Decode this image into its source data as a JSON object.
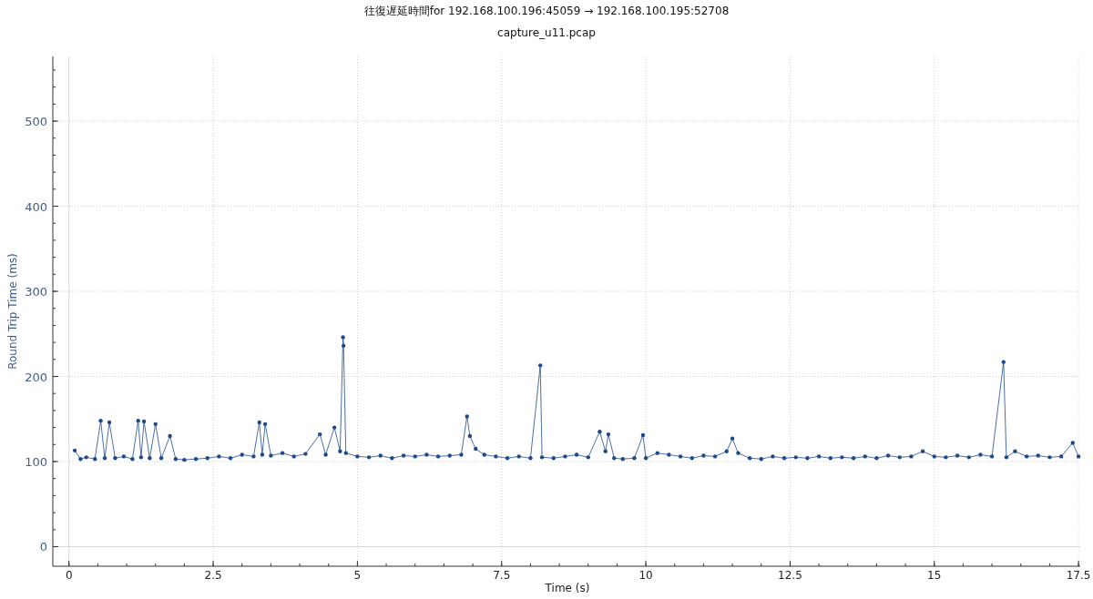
{
  "graph": {
    "subtitle": "capture_u11.pcap",
    "chart_data": {
      "type": "line",
      "title": "往復遅延時間for 192.168.100.196:45059 → 192.168.100.195:52708",
      "xlabel": "Time (s)",
      "ylabel": "Round Trip Time (ms)",
      "grid": true,
      "xlim": [
        -0.28,
        17.53
      ],
      "ylim": [
        -23,
        576
      ],
      "xticks": [
        0,
        {
          "value": 2.5,
          "label": "2.5"
        },
        5,
        {
          "value": 7.5,
          "label": "7.5"
        },
        10,
        {
          "value": 12.5,
          "label": "12.5"
        },
        15,
        {
          "value": 17.5,
          "label": "17.5"
        }
      ],
      "yticks": [
        0,
        100,
        200,
        300,
        400,
        500
      ],
      "x": [
        0.1,
        0.2,
        0.3,
        0.45,
        0.55,
        0.62,
        0.7,
        0.8,
        0.95,
        1.1,
        1.2,
        1.25,
        1.3,
        1.4,
        1.5,
        1.6,
        1.75,
        1.85,
        2.0,
        2.2,
        2.4,
        2.6,
        2.8,
        3.0,
        3.2,
        3.3,
        3.35,
        3.4,
        3.5,
        3.7,
        3.9,
        4.1,
        4.35,
        4.45,
        4.6,
        4.7,
        4.75,
        4.76,
        4.8,
        5.0,
        5.2,
        5.4,
        5.6,
        5.8,
        6.0,
        6.2,
        6.4,
        6.6,
        6.8,
        6.9,
        6.95,
        7.05,
        7.2,
        7.4,
        7.6,
        7.8,
        8.0,
        8.17,
        8.2,
        8.4,
        8.6,
        8.8,
        9.0,
        9.2,
        9.3,
        9.35,
        9.45,
        9.6,
        9.8,
        9.95,
        10.0,
        10.2,
        10.4,
        10.6,
        10.8,
        11.0,
        11.2,
        11.4,
        11.5,
        11.6,
        11.8,
        12.0,
        12.2,
        12.4,
        12.6,
        12.8,
        13.0,
        13.2,
        13.4,
        13.6,
        13.8,
        14.0,
        14.2,
        14.4,
        14.6,
        14.8,
        15.0,
        15.2,
        15.4,
        15.6,
        15.8,
        16.0,
        16.2,
        16.25,
        16.4,
        16.6,
        16.8,
        17.0,
        17.2,
        17.4,
        17.5
      ],
      "series": [
        {
          "color": "#1f4a8a",
          "values": [
            113,
            103,
            105,
            103,
            148,
            104,
            146,
            104,
            106,
            103,
            148,
            105,
            147,
            104,
            144,
            104,
            130,
            103,
            102,
            103,
            104,
            106,
            104,
            108,
            106,
            146,
            108,
            144,
            107,
            110,
            106,
            109,
            132,
            108,
            140,
            112,
            246,
            236,
            110,
            106,
            105,
            107,
            104,
            107,
            106,
            108,
            106,
            107,
            108,
            153,
            130,
            115,
            108,
            106,
            104,
            106,
            104,
            213,
            105,
            104,
            106,
            108,
            105,
            135,
            112,
            132,
            104,
            103,
            104,
            131,
            104,
            110,
            108,
            106,
            104,
            107,
            106,
            112,
            127,
            110,
            104,
            103,
            106,
            104,
            105,
            104,
            106,
            104,
            105,
            104,
            106,
            104,
            107,
            105,
            106,
            112,
            106,
            105,
            107,
            105,
            108,
            106,
            217,
            105,
            112,
            106,
            107,
            105,
            106,
            122,
            106
          ]
        }
      ]
    }
  }
}
